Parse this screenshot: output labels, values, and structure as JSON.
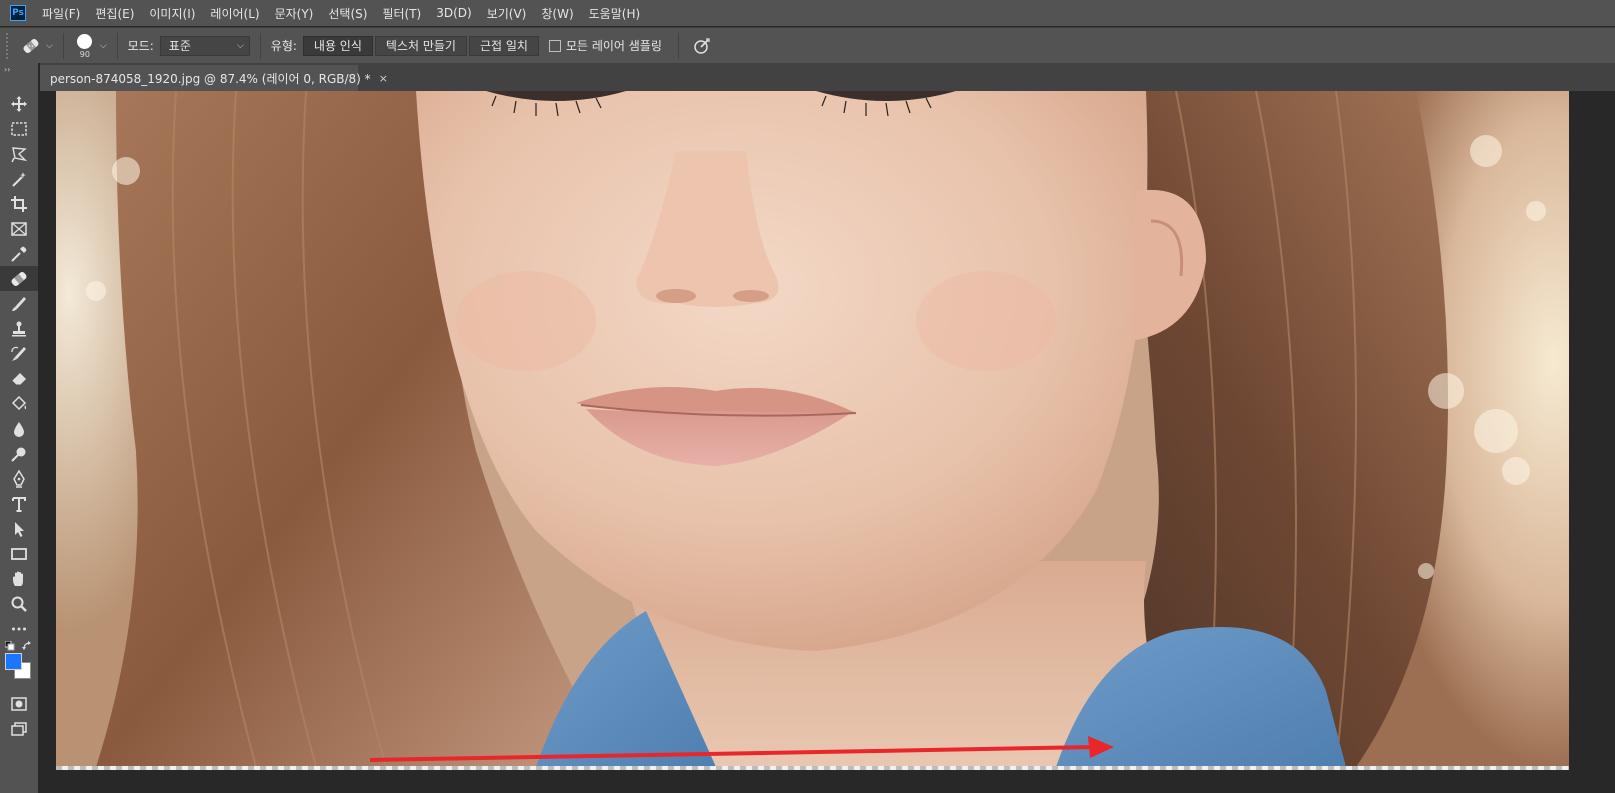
{
  "app": {
    "logo_text": "Ps"
  },
  "menu": {
    "items": [
      "파일(F)",
      "편집(E)",
      "이미지(I)",
      "레이어(L)",
      "문자(Y)",
      "선택(S)",
      "필터(T)",
      "3D(D)",
      "보기(V)",
      "창(W)",
      "도움말(H)"
    ]
  },
  "options": {
    "brush_size": "90",
    "mode_label": "모드:",
    "mode_value": "표준",
    "type_label": "유형:",
    "type_buttons": [
      "내용 인식",
      "텍스처 만들기",
      "근접 일치"
    ],
    "active_type_index": 0,
    "sample_all_layers_label": "모든 레이어 샘플링",
    "sample_all_layers_checked": false
  },
  "document": {
    "tab_title": "person-874058_1920.jpg @ 87.4% (레이어 0, RGB/8) *",
    "close_glyph": "×"
  },
  "toolbar": {
    "tools": [
      "move-tool-icon",
      "marquee-tool-icon",
      "lasso-tool-icon",
      "magic-wand-tool-icon",
      "crop-tool-icon",
      "frame-tool-icon",
      "eyedropper-tool-icon",
      "spot-healing-brush-tool-icon",
      "brush-tool-icon",
      "clone-stamp-tool-icon",
      "history-brush-tool-icon",
      "eraser-tool-icon",
      "paint-bucket-tool-icon",
      "blur-tool-icon",
      "dodge-tool-icon",
      "pen-tool-icon",
      "type-tool-icon",
      "path-selection-tool-icon",
      "rectangle-tool-icon",
      "hand-tool-icon",
      "zoom-tool-icon",
      "more-tools-icon"
    ],
    "selected_tool": "spot-healing-brush-tool-icon",
    "foreground_color": "#1a75ff",
    "background_color": "#ffffff"
  },
  "annotation": {
    "arrow_color": "#e8262b"
  }
}
